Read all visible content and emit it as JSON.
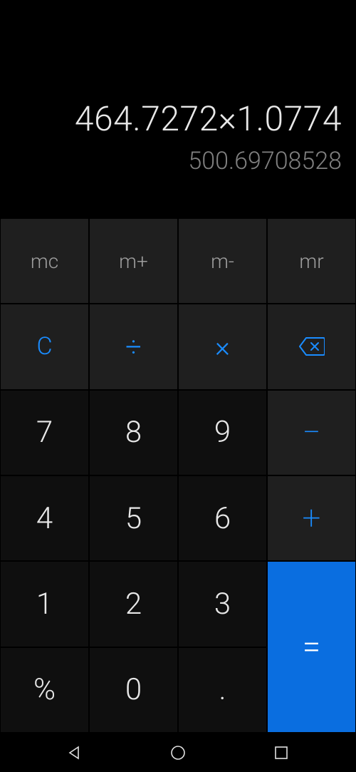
{
  "display": {
    "expression": "464.7272×1.0774",
    "result": "500.69708528"
  },
  "keys": {
    "mc": "mc",
    "m_plus": "m+",
    "m_minus": "m-",
    "mr": "mr",
    "clear": "C",
    "divide": "÷",
    "multiply": "×",
    "seven": "7",
    "eight": "8",
    "nine": "9",
    "minus": "−",
    "four": "4",
    "five": "5",
    "six": "6",
    "plus": "+",
    "one": "1",
    "two": "2",
    "three": "3",
    "equals": "=",
    "percent": "%",
    "zero": "0",
    "decimal": "."
  },
  "colors": {
    "accent_blue": "#1a8cff",
    "equals_bg": "#0a6ee0",
    "display_text": "#e8e8e8",
    "result_text": "#808080",
    "mem_text": "#9e9e9e"
  }
}
